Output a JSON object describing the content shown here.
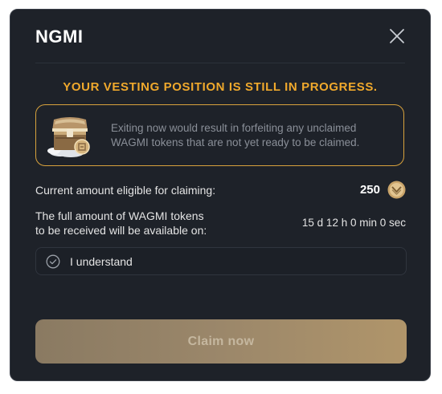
{
  "modal": {
    "title": "NGMI",
    "close_icon": "close-icon"
  },
  "warning": {
    "heading": "YOUR VESTING POSITION IS STILL IN PROGRESS.",
    "line1": "Exiting now would result in forfeiting any unclaimed",
    "line2": "WAGMI tokens that are not yet ready to be claimed.",
    "icon": "treasure-chest-icon",
    "accent_color": "#f0a92c"
  },
  "claimable": {
    "label": "Current amount eligible for claiming:",
    "value": "250",
    "icon": "wagmi-coin-icon"
  },
  "availability": {
    "label_line1": "The full amount of WAGMI tokens",
    "label_line2": "to be received will be available on:",
    "countdown": "15 d 12 h 0 min 0 sec"
  },
  "acknowledge": {
    "label": "I understand",
    "icon": "check-circle-icon",
    "checked": false
  },
  "claim_button": {
    "label": "Claim now",
    "enabled": false
  }
}
